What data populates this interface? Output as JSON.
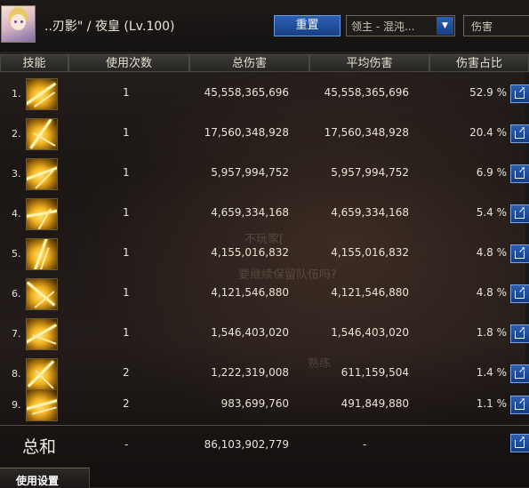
{
  "header": {
    "character_name": "..刃影\" / 夜皇 (Lv.100)",
    "reset_label": "重置",
    "target_selected": "领主 - 混沌...",
    "metric_selected": "伤害"
  },
  "columns": [
    "技能",
    "使用次数",
    "总伤害",
    "平均伤害",
    "伤害占比"
  ],
  "rows": [
    {
      "rank": "1.",
      "uses": "1",
      "total": "45,558,365,696",
      "avg": "45,558,365,696",
      "pct": "52.9 %"
    },
    {
      "rank": "2.",
      "uses": "1",
      "total": "17,560,348,928",
      "avg": "17,560,348,928",
      "pct": "20.4 %"
    },
    {
      "rank": "3.",
      "uses": "1",
      "total": "5,957,994,752",
      "avg": "5,957,994,752",
      "pct": "6.9 %"
    },
    {
      "rank": "4.",
      "uses": "1",
      "total": "4,659,334,168",
      "avg": "4,659,334,168",
      "pct": "5.4 %"
    },
    {
      "rank": "5.",
      "uses": "1",
      "total": "4,155,016,832",
      "avg": "4,155,016,832",
      "pct": "4.8 %"
    },
    {
      "rank": "6.",
      "uses": "1",
      "total": "4,121,546,880",
      "avg": "4,121,546,880",
      "pct": "4.8 %"
    },
    {
      "rank": "7.",
      "uses": "1",
      "total": "1,546,403,020",
      "avg": "1,546,403,020",
      "pct": "1.8 %"
    },
    {
      "rank": "8.",
      "uses": "2",
      "total": "1,222,319,008",
      "avg": "611,159,504",
      "pct": "1.4 %"
    },
    {
      "rank": "9.",
      "uses": "2",
      "total": "983,699,760",
      "avg": "491,849,880",
      "pct": "1.1 %"
    }
  ],
  "summary": {
    "label": "总和",
    "uses": "-",
    "total": "86,103,902,779",
    "avg": "-"
  },
  "footer": {
    "tab_label": "使用设置"
  },
  "background_text": {
    "line1": "不玩家[",
    "line2": "要继续保留队伍吗?",
    "line3": "熟练"
  },
  "icons": {
    "share": "share-icon",
    "dropdown": "chevron-down-icon"
  },
  "colors": {
    "button_blue": "#1f4fa0",
    "text": "#e8e4d6",
    "skill_gold": "#f0b020"
  }
}
